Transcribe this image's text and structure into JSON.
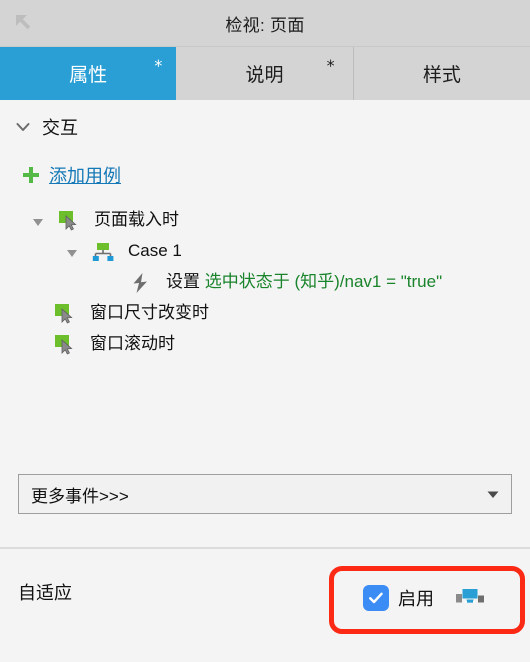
{
  "window": {
    "title": "检视: 页面",
    "back_icon": "back-arrow-icon"
  },
  "tabs": [
    {
      "label": "属性",
      "mark": "*",
      "active": true
    },
    {
      "label": "说明",
      "mark": "*",
      "active": false
    },
    {
      "label": "样式",
      "mark": "",
      "active": false
    }
  ],
  "interactions": {
    "section_title": "交互",
    "caret": "chevron-down-icon",
    "add_case": {
      "label": "添加用例",
      "icon": "plus-icon"
    },
    "tree": [
      {
        "label": "页面载入时",
        "icon": "event-cursor-icon",
        "twisty": "triangle-down-icon",
        "indent": "event"
      },
      {
        "label": "Case 1",
        "icon": "case-sitemap-icon",
        "twisty": "triangle-down-icon",
        "indent": "case"
      },
      {
        "icon": "lightning-bolt-icon",
        "indent": "action",
        "action_prefix": "设置 ",
        "action_target": "选中状态于 (知乎)/nav1 = \"true\""
      },
      {
        "label": "窗口尺寸改变时",
        "icon": "event-cursor-icon",
        "indent": "event-plain"
      },
      {
        "label": "窗口滚动时",
        "icon": "event-cursor-icon",
        "indent": "event-plain"
      }
    ],
    "more_events": {
      "label": "更多事件>>>",
      "caret": "dropdown-caret-icon"
    }
  },
  "bottom": {
    "adaptive_label": "自适应",
    "enable_label": "启用",
    "enable_checked": true,
    "views_icon": "adaptive-views-icon"
  },
  "colors": {
    "accent_blue": "#2a9fd6",
    "link_blue": "#1679b7",
    "green_text": "#19842b",
    "icon_green": "#6cbe2a",
    "icon_blue": "#1e9bd7",
    "checkbox_blue": "#3b8cf5",
    "annotation_red": "#fc2a15",
    "titlebar_grey": "#d4d4d4",
    "panel_bg": "#f4f4f4"
  }
}
